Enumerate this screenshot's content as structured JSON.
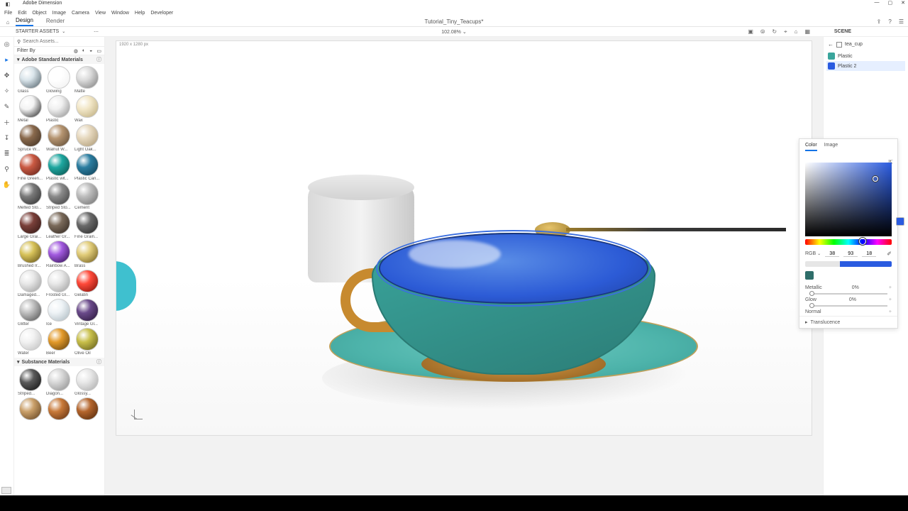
{
  "titlebar": {
    "app": "Adobe Dimension"
  },
  "menus": [
    "File",
    "Edit",
    "Object",
    "Image",
    "Camera",
    "View",
    "Window",
    "Help",
    "Developer"
  ],
  "modes": {
    "design": "Design",
    "render": "Render"
  },
  "doc_title": "Tutorial_Tiny_Teacups*",
  "zoom": "102.08% ⌄",
  "starter_label": "STARTER ASSETS",
  "scene_label": "SCENE",
  "search_placeholder": "Search Assets...",
  "filter_label": "Filter By",
  "section_adobe": "Adobe Standard Materials",
  "section_substance": "Substance Materials",
  "materials": [
    {
      "n": "Glass",
      "c1": "#d9e4ea",
      "c2": "#4a5a63"
    },
    {
      "n": "Glowing",
      "c1": "#ffffff",
      "c2": "#efefef"
    },
    {
      "n": "Matte",
      "c1": "#dcdcdc",
      "c2": "#7a7a7a"
    },
    {
      "n": "Metal",
      "c1": "#f3f3f3",
      "c2": "#1a1a1a"
    },
    {
      "n": "Plastic",
      "c1": "#f0f0f0",
      "c2": "#8c8c8c"
    },
    {
      "n": "Wax",
      "c1": "#f2e7c8",
      "c2": "#b9a878"
    },
    {
      "n": "Spruce W...",
      "c1": "#8a6a4d",
      "c2": "#3c2d20"
    },
    {
      "n": "Walnut W...",
      "c1": "#b59470",
      "c2": "#5a4733"
    },
    {
      "n": "Light Oak...",
      "c1": "#e6d8be",
      "c2": "#a99672"
    },
    {
      "n": "Fine Green...",
      "c1": "#ca5a43",
      "c2": "#5a1f17"
    },
    {
      "n": "Plastic wit...",
      "c1": "#1ea7a0",
      "c2": "#0a4b47"
    },
    {
      "n": "Plastic Can...",
      "c1": "#2b7da0",
      "c2": "#0e3a4e"
    },
    {
      "n": "Melted Sto...",
      "c1": "#7a7a7a",
      "c2": "#2c2c2c"
    },
    {
      "n": "Striped Sto...",
      "c1": "#8a8a8a",
      "c2": "#3c3c3c"
    },
    {
      "n": "Cement",
      "c1": "#bdbdbd",
      "c2": "#6c6c6c"
    },
    {
      "n": "Large Grai...",
      "c1": "#7a403a",
      "c2": "#2d1512"
    },
    {
      "n": "Leather Gr...",
      "c1": "#7a6a5a",
      "c2": "#2e251e"
    },
    {
      "n": "Fine Grain...",
      "c1": "#6a6a6a",
      "c2": "#262626"
    },
    {
      "n": "Brushed Ir...",
      "c1": "#d8c35a",
      "c2": "#5a4a14"
    },
    {
      "n": "Rainbow A...",
      "c1": "#a25adf",
      "c2": "#2c0e4a"
    },
    {
      "n": "Brass",
      "c1": "#e2cd7a",
      "c2": "#6a5618"
    },
    {
      "n": "Damaged...",
      "c1": "#e8e8e8",
      "c2": "#9a9a9a"
    },
    {
      "n": "Frosted Gl...",
      "c1": "#e8e8e8",
      "c2": "#9a9a9a"
    },
    {
      "n": "Gelatin",
      "c1": "#ff4a3a",
      "c2": "#7a0d06"
    },
    {
      "n": "Glitter",
      "c1": "#bfbfbf",
      "c2": "#4a4a4a"
    },
    {
      "n": "Ice",
      "c1": "#eef3f6",
      "c2": "#a7b5bd"
    },
    {
      "n": "Vintage Gl...",
      "c1": "#6a4a8a",
      "c2": "#241233"
    },
    {
      "n": "Water",
      "c1": "#f2f2f2",
      "c2": "#bcbcbc"
    },
    {
      "n": "Beer",
      "c1": "#e39a2a",
      "c2": "#5a3a0a"
    },
    {
      "n": "Olive Oil",
      "c1": "#c8bf4a",
      "c2": "#5a5518"
    }
  ],
  "substance_materials": [
    {
      "n": "Striped...",
      "c1": "#5a5a5a",
      "c2": "#0d0d0d"
    },
    {
      "n": "Diagon...",
      "c1": "#d8d8d8",
      "c2": "#8a8a8a"
    },
    {
      "n": "Glossy...",
      "c1": "#e8e8e8",
      "c2": "#a8a8a8"
    },
    {
      "n": "",
      "c1": "#caa06a",
      "c2": "#5a3c1c"
    },
    {
      "n": "",
      "c1": "#c87a3a",
      "c2": "#5a2c10"
    },
    {
      "n": "",
      "c1": "#b4652c",
      "c2": "#4a2408"
    }
  ],
  "scene": {
    "back_label": "tea_cup",
    "items": [
      {
        "label": "Plastic",
        "color": "#3aa59c",
        "sel": false
      },
      {
        "label": "Plastic 2",
        "color": "#2a5be0",
        "sel": true
      }
    ]
  },
  "colorpanel": {
    "tab_color": "Color",
    "tab_image": "Image",
    "mode": "RGB",
    "r": "38",
    "g": "93",
    "b": "18",
    "metallic_label": "Metallic",
    "metallic_val": "0%",
    "glow_label": "Glow",
    "glow_val": "0%",
    "normal_label": "Normal",
    "trans_label": "Translucence"
  },
  "canvas_dim": "1920 x 1280 px"
}
